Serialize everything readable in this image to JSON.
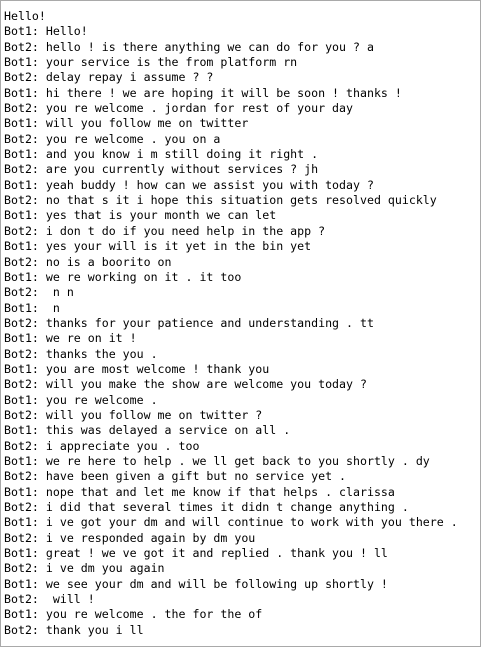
{
  "transcript": {
    "lines": [
      "Hello!",
      "Bot1: Hello!",
      "Bot2: hello ! is there anything we can do for you ? a",
      "Bot1: your service is the from platform rn",
      "Bot2: delay repay i assume ? ?",
      "Bot1: hi there ! we are hoping it will be soon ! thanks !",
      "Bot2: you re welcome . jordan for rest of your day",
      "Bot1: will you follow me on twitter",
      "Bot2: you re welcome . you on a",
      "Bot1: and you know i m still doing it right .",
      "Bot2: are you currently without services ? jh",
      "Bot1: yeah buddy ! how can we assist you with today ?",
      "Bot2: no that s it i hope this situation gets resolved quickly",
      "Bot1: yes that is your month we can let",
      "Bot2: i don t do if you need help in the app ?",
      "Bot1: yes your will is it yet in the bin yet",
      "Bot2: no is a boorito on",
      "Bot1: we re working on it . it too",
      "Bot2:  n n",
      "Bot1:  n",
      "Bot2: thanks for your patience and understanding . tt",
      "Bot1: we re on it !",
      "Bot2: thanks the you .",
      "Bot1: you are most welcome ! thank you",
      "Bot2: will you make the show are welcome you today ?",
      "Bot1: you re welcome .",
      "Bot2: will you follow me on twitter ?",
      "Bot1: this was delayed a service on all .",
      "Bot2: i appreciate you . too",
      "Bot1: we re here to help . we ll get back to you shortly . dy",
      "Bot2: have been given a gift but no service yet .",
      "Bot1: nope that and let me know if that helps . clarissa",
      "Bot2: i did that several times it didn t change anything .",
      "Bot1: i ve got your dm and will continue to work with you there .",
      "Bot2: i ve responded again by dm you",
      "Bot1: great ! we ve got it and replied . thank you ! ll",
      "Bot2: i ve dm you again",
      "Bot1: we see your dm and will be following up shortly !",
      "Bot2:  will !",
      "Bot1: you re welcome . the for the of",
      "Bot2: thank you i ll"
    ]
  }
}
